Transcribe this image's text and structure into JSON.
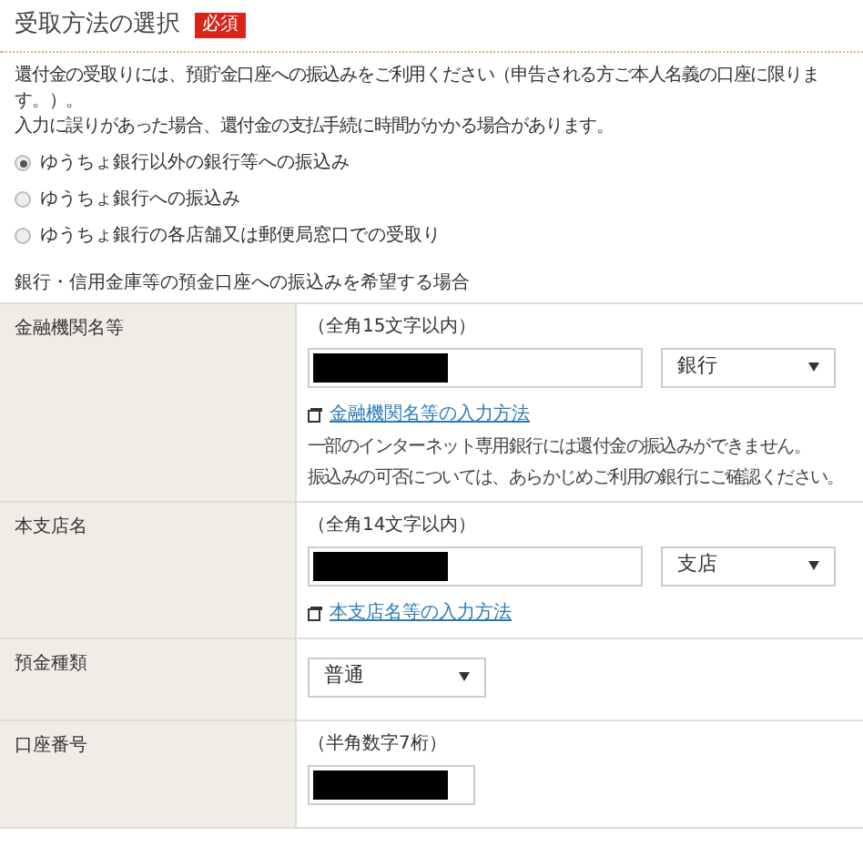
{
  "section": {
    "title": "受取方法の選択",
    "badge": "必須"
  },
  "description": [
    "還付金の受取りには、預貯金口座への振込みをご利用ください（申告される方ご本人名義の口座に限ります。）。",
    "入力に誤りがあった場合、還付金の支払手続に時間がかかる場合があります。"
  ],
  "options": [
    {
      "label": "ゆうちょ銀行以外の銀行等への振込み",
      "selected": true
    },
    {
      "label": "ゆうちょ銀行への振込み",
      "selected": false
    },
    {
      "label": "ゆうちょ銀行の各店舗又は郵便局窓口での受取り",
      "selected": false
    }
  ],
  "subsection_title": "銀行・信用金庫等の預金口座への振込みを希望する場合",
  "form_rows": [
    {
      "kind": "text_and_select",
      "label": "金融機関名等",
      "hint": "（全角15文字以内）",
      "select": "銀行",
      "link": "金融機関名等の入力方法",
      "notes": [
        "一部のインターネット専用銀行には還付金の振込みができません。",
        "振込みの可否については、あらかじめご利用の銀行にご確認ください。"
      ]
    },
    {
      "kind": "text_and_select",
      "label": "本支店名",
      "hint": "（全角14文字以内）",
      "select": "支店",
      "link": "本支店名等の入力方法"
    },
    {
      "kind": "select_only",
      "label": "預金種類",
      "select": "普通"
    },
    {
      "kind": "short_text",
      "label": "口座番号",
      "hint": "（半角数字7桁）"
    }
  ]
}
